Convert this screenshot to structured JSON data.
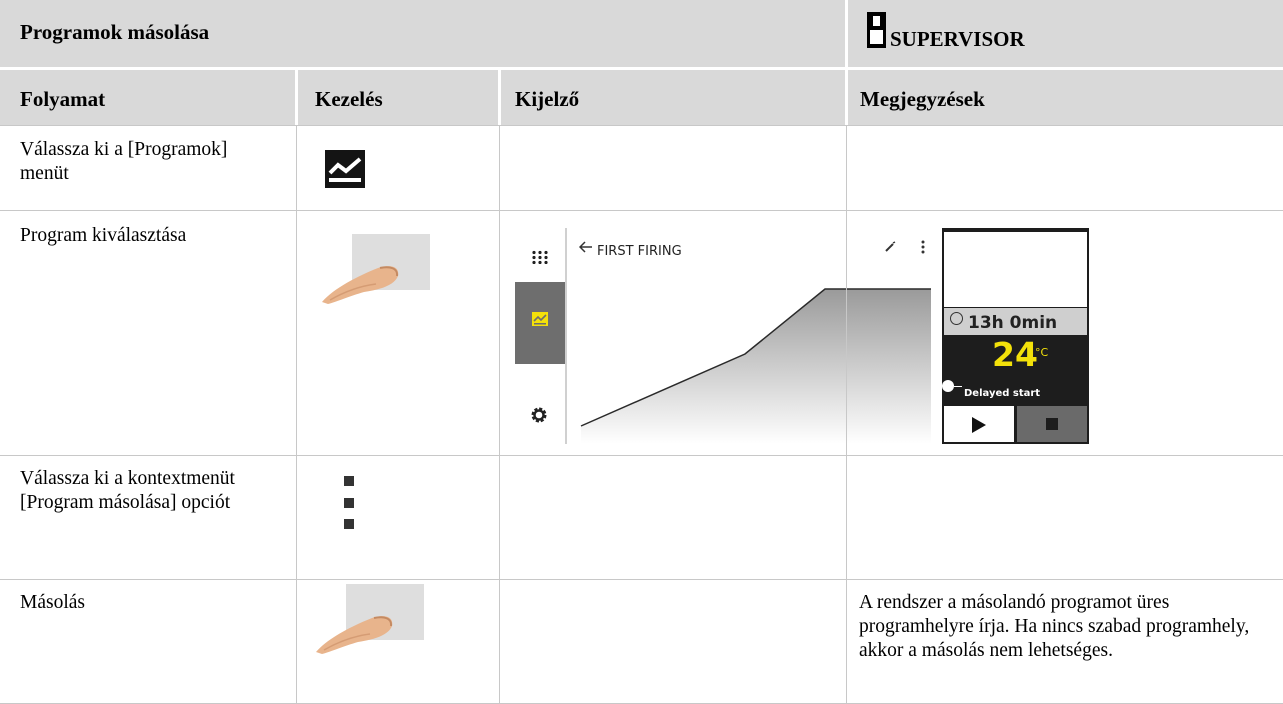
{
  "header": {
    "title": "Programok másolása",
    "role": "SUPERVISOR",
    "role_icon": "user-icon"
  },
  "columns": [
    "Folyamat",
    "Kezelés",
    "Kijelző",
    "Megjegyzések"
  ],
  "rows": [
    {
      "step": "Válassza ki a [Programok] menüt",
      "action_icon": "program-chart-icon",
      "note": ""
    },
    {
      "step": "Program kiválasztása",
      "action_icon": "finger-tap-icon",
      "note": ""
    },
    {
      "step": "Válassza ki a kontextmenüt [Program másolása] opciót",
      "action_icon": "kebab-menu-icon",
      "note": ""
    },
    {
      "step": "Másolás",
      "action_icon": "finger-tap-icon",
      "note": "A rendszer a másolandó programot üres programhelyre írja. Ha nincs szabad programhely, akkor a másolás nem lehetséges."
    }
  ],
  "screen": {
    "program_name": "FIRST FIRING",
    "back_icon": "arrow-left-icon",
    "duration": "13h 0min",
    "temperature": "24",
    "temperature_unit": "°C",
    "delayed_label": "Delayed start",
    "accent_color": "#f3e10a"
  }
}
